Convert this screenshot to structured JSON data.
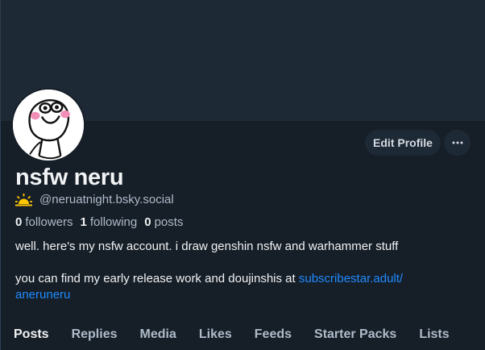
{
  "profile": {
    "display_name": "nsfw neru",
    "handle": "@neruatnight.bsky.social",
    "handle_icon": "sun-icon",
    "avatar_icon": "cartoon-face-icon",
    "stats": {
      "followers_count": "0",
      "followers_label": "followers",
      "following_count": "1",
      "following_label": "following",
      "posts_count": "0",
      "posts_label": "posts"
    },
    "bio_line1": "well. here's my nsfw account. i draw genshin nsfw and warhammer stuff",
    "bio_line2_prefix": "you can find my early release work and doujinshis at ",
    "bio_link_part1": "subscribestar.adult/",
    "bio_link_part2": "aneruneru"
  },
  "actions": {
    "edit_profile": "Edit Profile",
    "more_icon": "ellipsis-icon"
  },
  "tabs": [
    "Posts",
    "Replies",
    "Media",
    "Likes",
    "Feeds",
    "Starter Packs",
    "Lists"
  ],
  "active_tab": "Posts",
  "colors": {
    "background": "#161e27",
    "banner": "#1e2936",
    "text": "#f1f3f5",
    "muted": "#aebbc9",
    "link": "#208bfe",
    "sun": "#ffc700"
  }
}
